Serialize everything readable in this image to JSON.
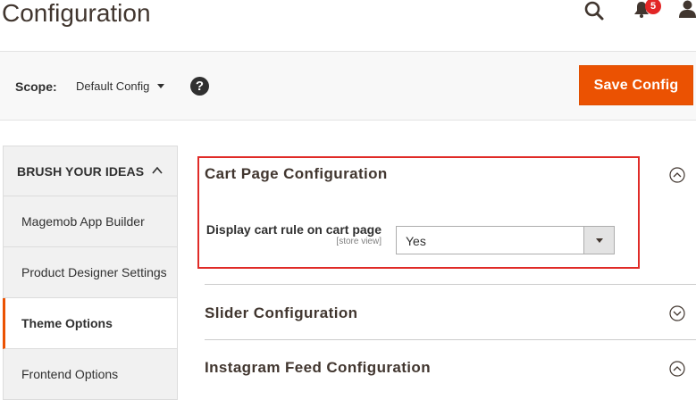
{
  "header": {
    "title": "Configuration",
    "notifications_count": "5",
    "icons": [
      "search-icon",
      "bell-icon",
      "user-icon"
    ]
  },
  "page_actions": {
    "scope_label": "Scope:",
    "scope_value": "Default Config",
    "help_icon": "question-mark-icon",
    "save_label": "Save Config"
  },
  "sidebar": {
    "section_title": "BRUSH YOUR IDEAS",
    "section_expanded": true,
    "items": [
      {
        "label": "Magemob App Builder",
        "active": false
      },
      {
        "label": "Product Designer Settings",
        "active": false
      },
      {
        "label": "Theme Options",
        "active": true
      },
      {
        "label": "Frontend Options",
        "active": false
      }
    ]
  },
  "main": {
    "sections": [
      {
        "title": "Cart Page Configuration",
        "expanded": true
      },
      {
        "title": "Slider Configuration",
        "expanded": false
      },
      {
        "title": "Instagram Feed Configuration",
        "expanded": true
      }
    ],
    "cart_field": {
      "label": "Display cart rule on cart page",
      "scope": "[store view]",
      "value": "Yes"
    }
  },
  "colors": {
    "accent": "#eb5202",
    "highlight": "#e02b27",
    "badge": "#e22626",
    "text": "#303030",
    "title": "#41362f"
  }
}
